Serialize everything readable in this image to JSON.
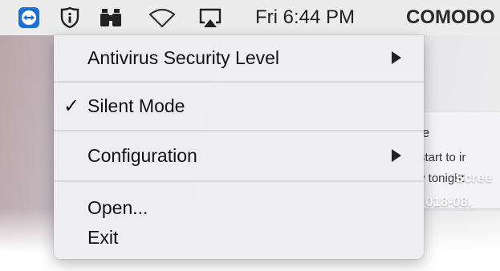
{
  "menubar": {
    "clock": "Fri 6:44 PM",
    "app_name": "COMODO",
    "icons": [
      "teamviewer-icon",
      "shield-info-icon",
      "binoculars-icon",
      "wifi-icon",
      "airplay-icon"
    ]
  },
  "desktop": {
    "notification_lines": [
      "le",
      "start to ir",
      "y tonight"
    ],
    "screenshot_label_1": "Scree",
    "screenshot_label_2": "018-08."
  },
  "menu": {
    "items": [
      {
        "label": "Antivirus Security Level",
        "has_submenu": true,
        "checked": false
      },
      {
        "label": "Silent Mode",
        "has_submenu": false,
        "checked": true
      },
      {
        "label": "Configuration",
        "has_submenu": true,
        "checked": false
      },
      {
        "label": "Open...",
        "has_submenu": false,
        "checked": false
      },
      {
        "label": "Exit",
        "has_submenu": false,
        "checked": false
      }
    ],
    "checkmark": "✓"
  },
  "colors": {
    "teamviewer_blue": "#1d6fd6",
    "menu_background": "#efeff1",
    "menubar_background": "#ececec"
  }
}
